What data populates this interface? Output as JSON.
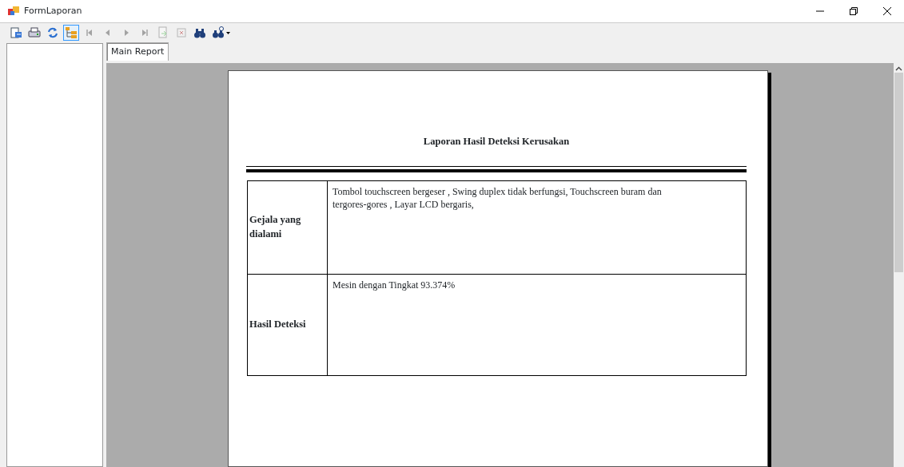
{
  "window": {
    "title": "FormLaporan"
  },
  "toolbar": [
    {
      "kind": "export",
      "disabled": false,
      "selected": false
    },
    {
      "kind": "print",
      "disabled": false,
      "selected": false
    },
    {
      "kind": "refresh",
      "disabled": false,
      "selected": false
    },
    {
      "kind": "tree",
      "disabled": false,
      "selected": true
    },
    {
      "kind": "first",
      "disabled": true,
      "selected": false
    },
    {
      "kind": "prev",
      "disabled": true,
      "selected": false
    },
    {
      "kind": "next",
      "disabled": true,
      "selected": false
    },
    {
      "kind": "last",
      "disabled": true,
      "selected": false
    },
    {
      "kind": "goto",
      "disabled": true,
      "selected": false
    },
    {
      "kind": "stop",
      "disabled": true,
      "selected": false
    },
    {
      "kind": "find",
      "disabled": false,
      "selected": false
    },
    {
      "kind": "zoom",
      "disabled": false,
      "selected": false
    }
  ],
  "tabs": [
    {
      "label": "Main Report",
      "selected": true
    }
  ],
  "report": {
    "title": "Laporan Hasil Deteksi Kerusakan",
    "rows": [
      {
        "label": "Gejala yang dialami",
        "value": "Tombol touchscreen bergeser , Swing duplex tidak berfungsi, Touchscreen buram dan tergores-gores , Layar LCD bergaris,"
      },
      {
        "label": "Hasil Deteksi",
        "value": "Mesin dengan Tingkat 93.374%"
      }
    ]
  }
}
